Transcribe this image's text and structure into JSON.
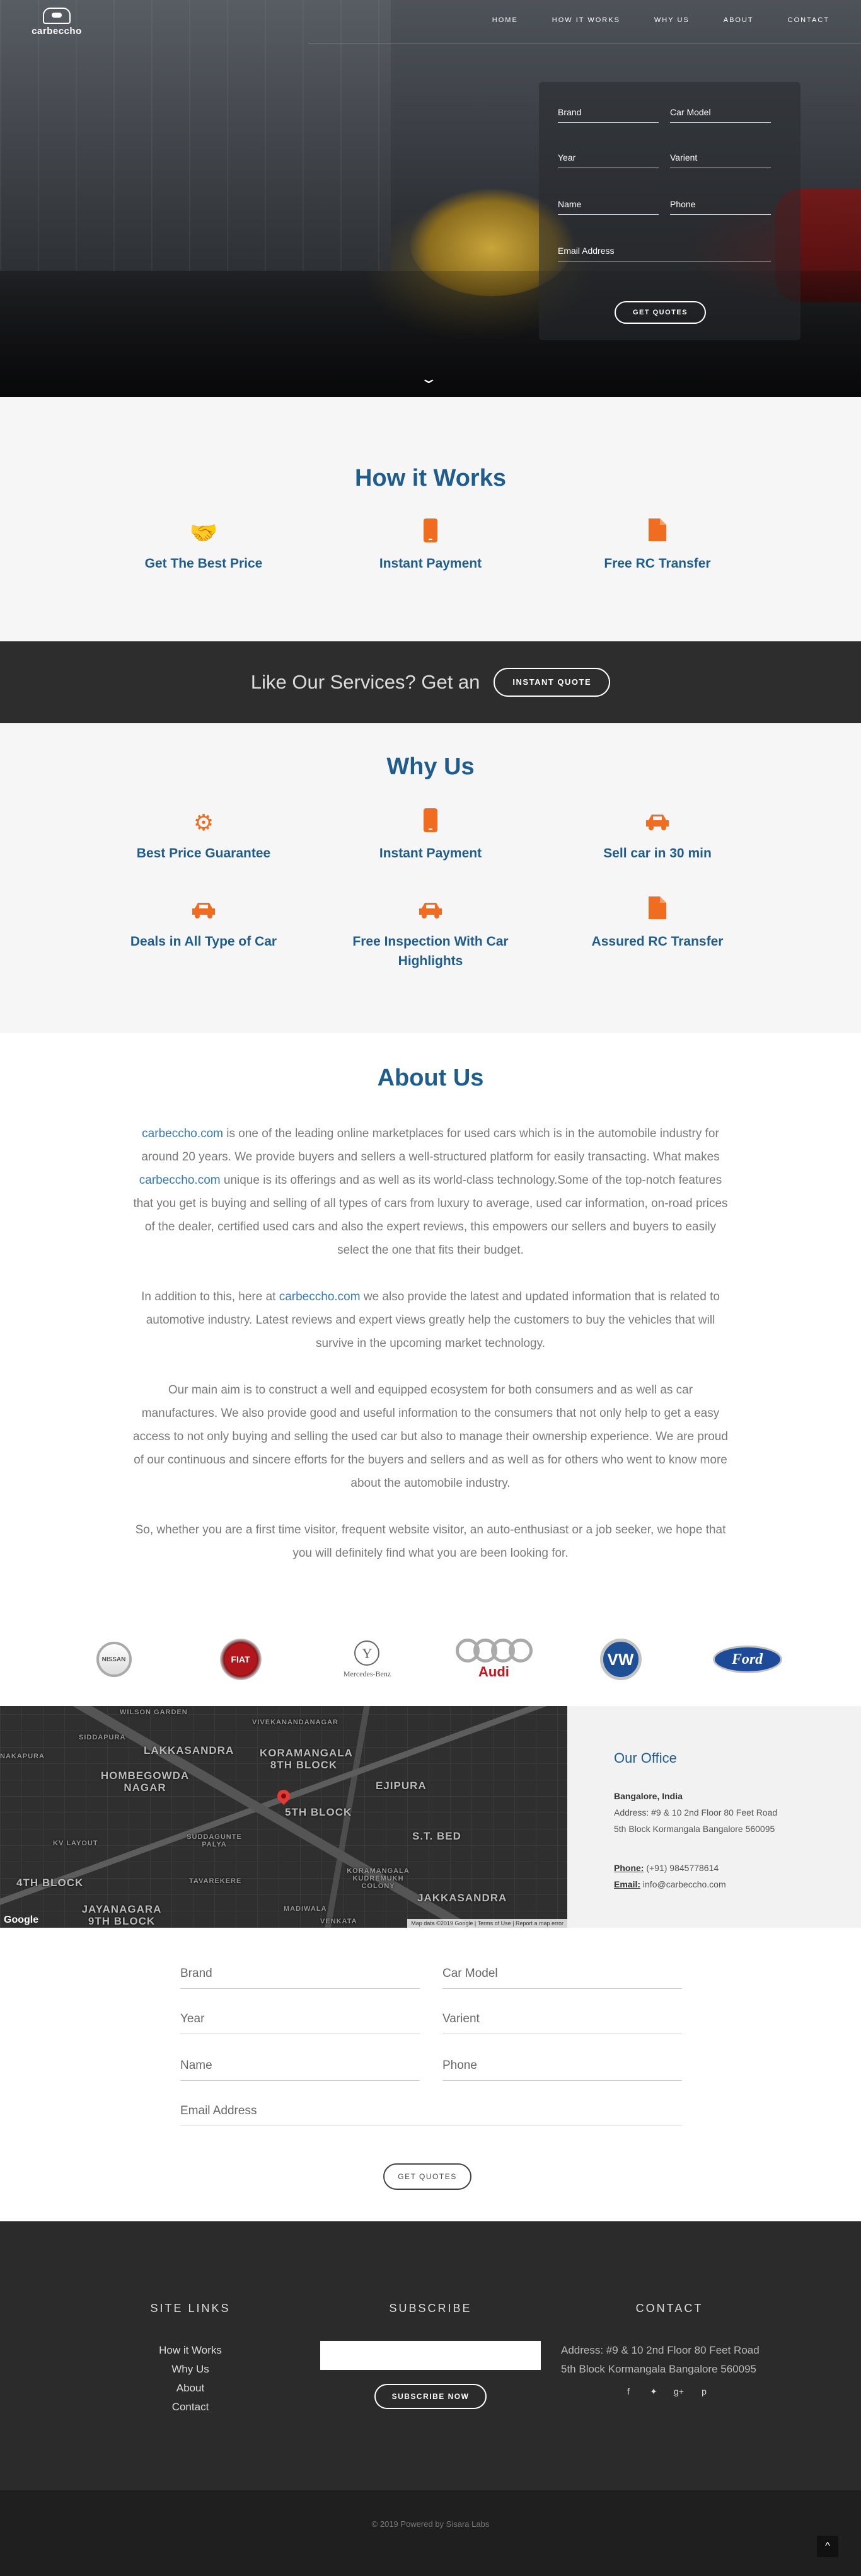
{
  "brand": {
    "name": "carbeccho"
  },
  "nav": {
    "items": [
      {
        "label": "HOME"
      },
      {
        "label": "HOW IT WORKS"
      },
      {
        "label": "WHY US"
      },
      {
        "label": "ABOUT"
      },
      {
        "label": "CONTACT"
      }
    ]
  },
  "hero_form": {
    "brand": "Brand",
    "car_model": "Car Model",
    "year": "Year",
    "variant": "Varient",
    "name": "Name",
    "phone": "Phone",
    "email": "Email Address",
    "submit": "GET QUOTES"
  },
  "how_it_works": {
    "title": "How it Works",
    "items": [
      {
        "icon": "handshake-icon",
        "label": "Get The Best Price"
      },
      {
        "icon": "mobile-icon",
        "label": "Instant Payment"
      },
      {
        "icon": "document-icon",
        "label": "Free RC Transfer"
      }
    ]
  },
  "cta": {
    "text": "Like Our Services? Get an",
    "button": "INSTANT QUOTE"
  },
  "why_us": {
    "title": "Why Us",
    "row1": [
      {
        "icon": "gear-icon",
        "label": "Best Price Guarantee"
      },
      {
        "icon": "mobile-icon",
        "label": "Instant Payment"
      },
      {
        "icon": "car-icon",
        "label": "Sell car in 30 min"
      }
    ],
    "row2": [
      {
        "icon": "car-icon",
        "label": "Deals in All Type of Car"
      },
      {
        "icon": "car-icon",
        "label": "Free Inspection With Car Highlights"
      },
      {
        "icon": "document-icon",
        "label": "Assured RC Transfer"
      }
    ]
  },
  "about": {
    "title": "About Us",
    "p1_link1": "carbeccho.com",
    "p1_text1": " is one of the leading online marketplaces for used cars which is in the automobile industry for around 20 years. We provide buyers and sellers a well-structured platform for easily transacting. What makes ",
    "p1_link2": "carbeccho.com",
    "p1_text2": " unique is its offerings and as well as its world-class technology.Some of the top-notch features that you get is buying and selling of all types of cars from luxury to average, used car information, on-road prices of the dealer, certified used cars and also the expert reviews, this empowers our sellers and buyers to easily select the one that fits their budget.",
    "p2_text1": "In addition to this, here at ",
    "p2_link": "carbeccho.com",
    "p2_text2": " we also provide the latest and updated information that is related to automotive industry. Latest reviews and expert views greatly help the customers to buy the vehicles that will survive in the upcoming market technology.",
    "p3": "Our main aim is to construct a well and equipped ecosystem for both consumers and as well as car manufactures. We also provide good and useful information to the consumers that not only help to get a easy access to not only buying and selling the used car but also to manage their ownership experience. We are proud of our continuous and sincere efforts for the buyers and sellers and as well as for others who went to know more about the automobile industry.",
    "p4": "So, whether you are a first time visitor, frequent website visitor, an auto-enthusiast or a job seeker, we hope that you will definitely find what you are been looking for."
  },
  "brands": {
    "nissan": "NISSAN",
    "fiat": "FIAT",
    "mercedes": "Mercedes-Benz",
    "audi": "Audi",
    "vw": "VW",
    "ford": "Ford"
  },
  "map": {
    "labels": {
      "wilson_garden": "WILSON GARDEN",
      "vivekanandanagar": "VIVEKANANDANAGAR",
      "siddapura": "SIDDAPURA",
      "lakkasandra": "LAKKASANDRA",
      "koramangala_8th": "KORAMANGALA 8TH BLOCK",
      "nakapura": "NAKAPURA",
      "hombegowda": "HOMBEGOWDA NAGAR",
      "ejipura": "EJIPURA",
      "block5": "5TH BLOCK",
      "st_bed": "S.T. BED",
      "kv_layout": "KV LAYOUT",
      "suddagunte": "SUDDAGUNTE PALYA",
      "tavarekere": "TAVAREKERE",
      "koramangala_kudremukh": "KORAMANGALA KUDREMUKH COLONY",
      "block4": "4TH BLOCK",
      "jakkasandra": "JAKKASANDRA",
      "jayanagara": "JAYANAGARA 9TH BLOCK",
      "madiwala": "MADIWALA",
      "venkata": "VENKATA"
    },
    "google": "Google",
    "attribution": "Map data ©2019 Google | Terms of Use | Report a map error"
  },
  "office": {
    "title": "Our Office",
    "city": "Bangalore, India",
    "address1": "Address: #9 & 10 2nd Floor 80 Feet Road",
    "address2": "5th Block Kormangala Bangalore 560095",
    "phone_label": "Phone:",
    "phone": " (+91) 9845778614",
    "email_label": "Email:",
    "email": " info@carbeccho.com"
  },
  "bottom_form": {
    "brand": "Brand",
    "car_model": "Car Model",
    "year": "Year",
    "variant": "Varient",
    "name": "Name",
    "phone": "Phone",
    "email": "Email Address",
    "submit": "GET QUOTES"
  },
  "footer": {
    "site_links_title": "SITE LINKS",
    "links": [
      {
        "label": "How it Works"
      },
      {
        "label": "Why Us"
      },
      {
        "label": "About"
      },
      {
        "label": "Contact"
      }
    ],
    "subscribe_title": "SUBSCRIBE",
    "subscribe_button": "SUBSCRIBE NOW",
    "contact_title": "CONTACT",
    "address1": "Address: #9 & 10 2nd Floor 80 Feet Road",
    "address2": "5th Block Kormangala Bangalore 560095",
    "socials": [
      "facebook-icon",
      "twitter-icon",
      "google-plus-icon",
      "pinterest-icon"
    ],
    "copyright": "© 2019 Powered by Sisara Labs",
    "to_top": "^"
  },
  "colors": {
    "accent_orange": "#ef6c21",
    "heading_blue": "#1e5d8e",
    "link_blue": "#3578b6",
    "dark_band": "#2d2d2d"
  }
}
